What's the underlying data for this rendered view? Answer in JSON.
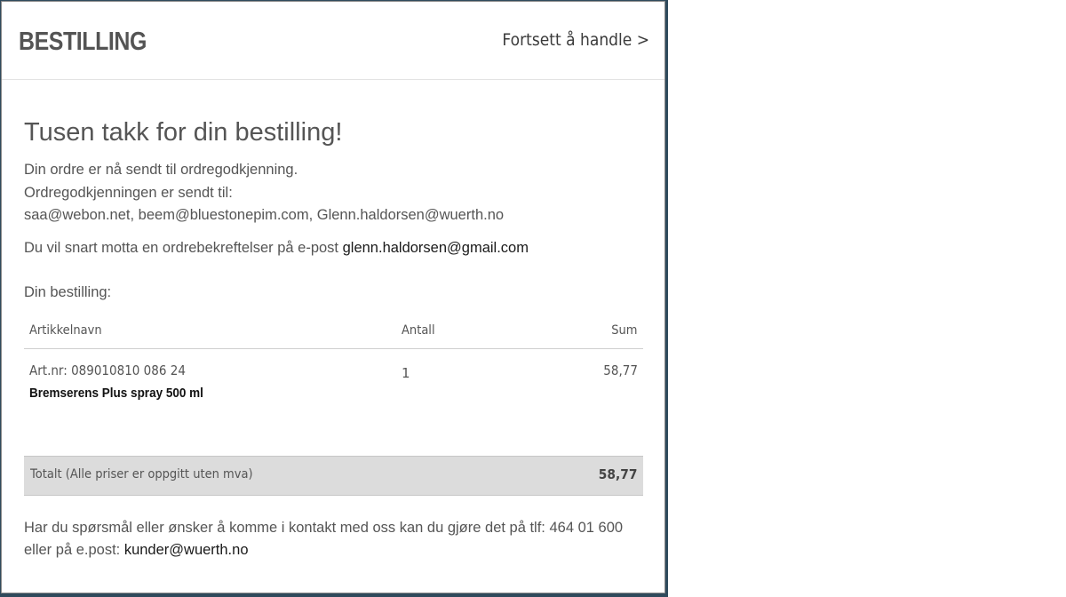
{
  "colors": {
    "backdrop": "#2f4a5c",
    "header_text": "#545454",
    "body_text": "#555555",
    "link_text": "#1a1a1a",
    "total_bar": "#dcdcdc"
  },
  "header": {
    "title": "BESTILLING",
    "continue_link": "Fortsett å handle >"
  },
  "confirmation": {
    "heading": "Tusen takk for din bestilling!",
    "approval_sent": "Din ordre er nå sendt til ordregodkjenning.",
    "approval_recipients_label": "Ordregodkjenningen er sendt til:",
    "approval_recipients": "saa@webon.net, beem@bluestonepim.com, Glenn.haldorsen@wuerth.no",
    "confirmation_text": "Du vil snart motta en ordrebekreftelser på e-post",
    "confirmation_email": "glenn.haldorsen@gmail.com",
    "order_label": "Din bestilling:"
  },
  "order_table": {
    "columns": [
      "Artikkelnavn",
      "Antall",
      "Sum"
    ],
    "rows": [
      {
        "article_number": "Art.nr: 089010810 086 24",
        "name": "Bremserens Plus spray 500 ml",
        "quantity": "1",
        "sum": "58,77"
      }
    ],
    "total_label": "Totalt (Alle priser er oppgitt uten mva)",
    "total_value": "58,77"
  },
  "contact": {
    "text": "Har du spørsmål eller ønsker å komme i kontakt med oss kan du gjøre det på tlf: 464 01 600 eller på e.post:",
    "email": "kunder@wuerth.no"
  }
}
